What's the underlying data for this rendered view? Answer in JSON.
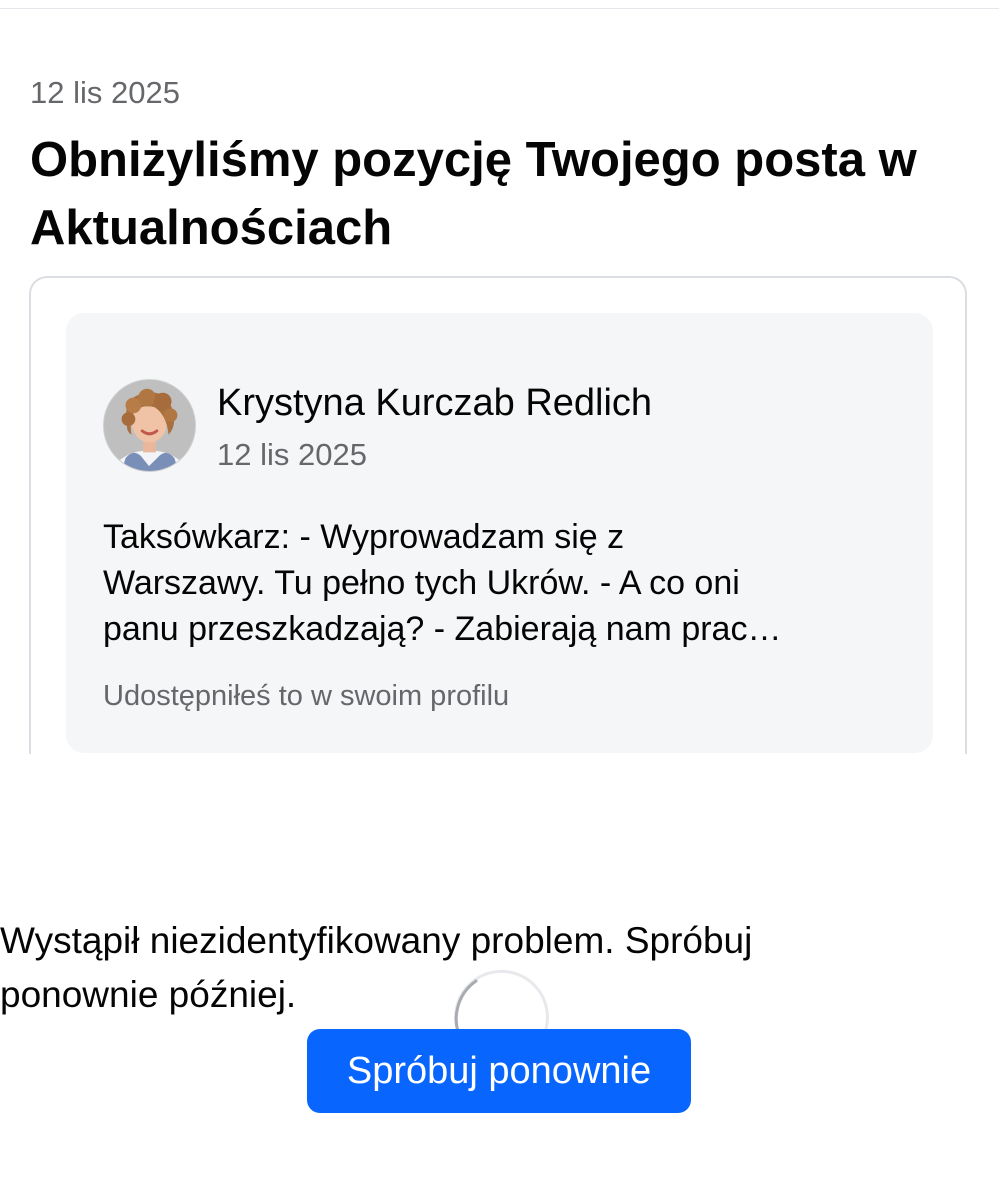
{
  "notice": {
    "date": "12 lis 2025",
    "title": "Obniżyliśmy pozycję Twojego posta w Aktualnościach"
  },
  "post": {
    "author": "Krystyna Kurczab Redlich",
    "date": "12 lis 2025",
    "text_lines": [
      "Taksówkarz: - Wyprowadzam się z",
      "Warszawy. Tu pełno tych Ukrów. - A co oni",
      "panu przeszkadzają? - Zabierają nam prac…"
    ],
    "shared_note": "Udostępniłeś to w swoim profilu"
  },
  "error": {
    "message": "Wystąpił niezidentyfikowany problem. Spróbuj ponownie później.",
    "retry_label": "Spróbuj ponownie"
  },
  "icons": {
    "loading": "loading-spinner-icon"
  },
  "colors": {
    "primary_button": "#0866ff",
    "secondary_text": "#65676b",
    "preview_background": "#f5f6f7",
    "card_border": "#dadde1"
  }
}
